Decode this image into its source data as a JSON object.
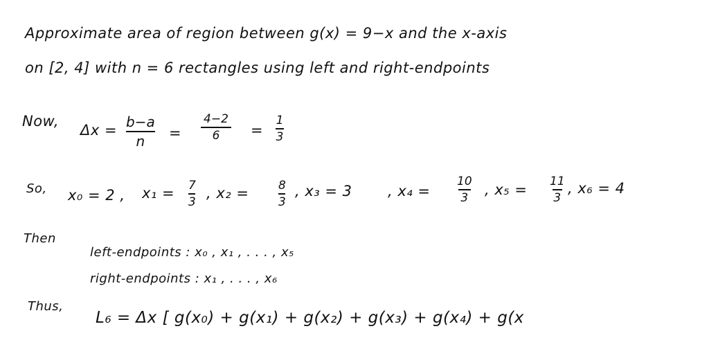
{
  "problem": {
    "line1": "Approximate   area  of  region   between   g(x) = 9−x    and  the  x-axis",
    "line2": "on [2, 4]   with  n = 6  rectangles    using   left  and  right-endpoints"
  },
  "delta": {
    "label": "Now,",
    "lhs": "Δx =",
    "frac1_num": "b−a",
    "frac1_den": "n",
    "eq1": "=",
    "frac2_num": "4−2",
    "frac2_den": "6",
    "eq2": "=",
    "frac3_num": "1",
    "frac3_den": "3"
  },
  "points": {
    "label": "So,",
    "x0": "x₀ = 2 ,",
    "x1_lhs": "x₁ =",
    "x1_num": "7",
    "x1_den": "3",
    "x2_lhs": ", x₂ =",
    "x2_num": "8",
    "x2_den": "3",
    "x3": ", x₃  =  3",
    "x4_lhs": ", x₄ =",
    "x4_num": "10",
    "x4_den": "3",
    "x5_lhs": ",  x₅ =",
    "x5_num": "11",
    "x5_den": "3",
    "x6": ",  x₆ = 4"
  },
  "endpoints": {
    "label": "Then",
    "left": "left-endpoints  :   x₀ ,  x₁ ,   . . .  , x₅",
    "right": "right-endpoints :   x₁ , . . .   , x₆"
  },
  "sum": {
    "label": "Thus,",
    "expr": "L₆  =  Δx [ g(x₀)   +   g(x₁)  + g(x₂) + g(x₃)  + g(x₄)  + g(x"
  }
}
